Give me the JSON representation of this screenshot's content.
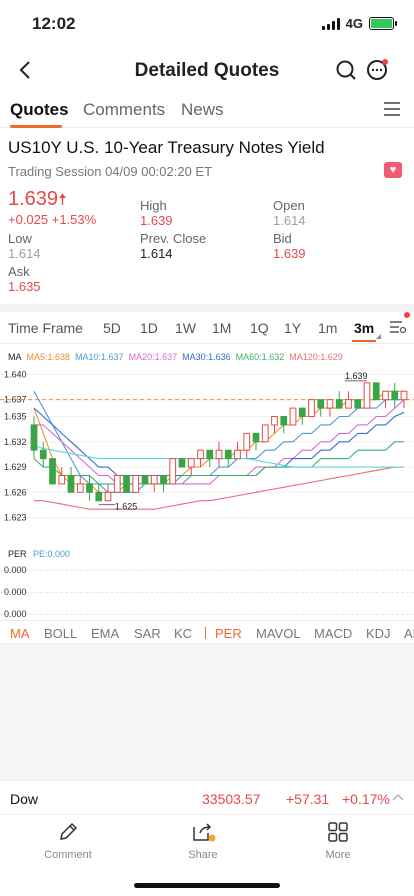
{
  "status": {
    "time": "12:02",
    "network": "4G"
  },
  "nav": {
    "title": "Detailed Quotes"
  },
  "tabs": [
    "Quotes",
    "Comments",
    "News"
  ],
  "quote": {
    "symbol_name": "US10Y  U.S. 10-Year Treasury Notes Yield",
    "session": "Trading Session 04/09 00:02:20 ET",
    "price": "1.639",
    "change": "+0.025  +1.53%",
    "high_label": "High",
    "high": "1.639",
    "open_label": "Open",
    "open": "1.614",
    "low_label": "Low",
    "low": "1.614",
    "prev_close_label": "Prev. Close",
    "prev_close": "1.614",
    "bid_label": "Bid",
    "bid": "1.639",
    "ask_label": "Ask",
    "ask": "1.635"
  },
  "timeframes": [
    "Time Frame",
    "5D",
    "1D",
    "1W",
    "1M",
    "1Q",
    "1Y",
    "1m",
    "3m"
  ],
  "active_timeframe": "3m",
  "ma_legend": [
    {
      "label": "MA",
      "color": "#222222"
    },
    {
      "label": "MA5:1.638",
      "color": "#f0922b"
    },
    {
      "label": "MA10:1.637",
      "color": "#4a9bd8"
    },
    {
      "label": "MA20:1.637",
      "color": "#d768d8"
    },
    {
      "label": "MA30:1.636",
      "color": "#2f6fd0"
    },
    {
      "label": "MA60:1.632",
      "color": "#3cb371"
    },
    {
      "label": "MA120:1.629",
      "color": "#e8707a"
    }
  ],
  "colors": {
    "up": "#e64a4a",
    "down": "#3aa547",
    "accent": "#f06a2b"
  },
  "chart_data": {
    "type": "candlestick",
    "y_ticks": [
      "1.640",
      "1.637",
      "1.635",
      "1.632",
      "1.629",
      "1.626",
      "1.623"
    ],
    "ylim": [
      1.622,
      1.641
    ],
    "ref_line": 1.637,
    "annotations": {
      "high": "1.639",
      "low": "1.625"
    },
    "ohlc": [
      [
        1.634,
        1.635,
        1.63,
        1.631
      ],
      [
        1.631,
        1.632,
        1.629,
        1.63
      ],
      [
        1.63,
        1.63,
        1.627,
        1.627
      ],
      [
        1.627,
        1.629,
        1.627,
        1.628
      ],
      [
        1.628,
        1.629,
        1.626,
        1.626
      ],
      [
        1.626,
        1.628,
        1.626,
        1.627
      ],
      [
        1.627,
        1.628,
        1.625,
        1.626
      ],
      [
        1.626,
        1.627,
        1.625,
        1.625
      ],
      [
        1.625,
        1.627,
        1.625,
        1.626
      ],
      [
        1.626,
        1.628,
        1.626,
        1.628
      ],
      [
        1.628,
        1.628,
        1.626,
        1.626
      ],
      [
        1.626,
        1.628,
        1.626,
        1.628
      ],
      [
        1.628,
        1.628,
        1.627,
        1.627
      ],
      [
        1.627,
        1.628,
        1.626,
        1.628
      ],
      [
        1.628,
        1.628,
        1.626,
        1.627
      ],
      [
        1.627,
        1.63,
        1.627,
        1.63
      ],
      [
        1.63,
        1.63,
        1.629,
        1.629
      ],
      [
        1.629,
        1.63,
        1.628,
        1.63
      ],
      [
        1.63,
        1.631,
        1.629,
        1.631
      ],
      [
        1.631,
        1.631,
        1.629,
        1.63
      ],
      [
        1.63,
        1.632,
        1.629,
        1.631
      ],
      [
        1.631,
        1.631,
        1.629,
        1.63
      ],
      [
        1.63,
        1.632,
        1.63,
        1.631
      ],
      [
        1.631,
        1.633,
        1.63,
        1.633
      ],
      [
        1.633,
        1.633,
        1.631,
        1.632
      ],
      [
        1.632,
        1.634,
        1.632,
        1.634
      ],
      [
        1.634,
        1.635,
        1.633,
        1.635
      ],
      [
        1.635,
        1.635,
        1.633,
        1.634
      ],
      [
        1.634,
        1.636,
        1.634,
        1.636
      ],
      [
        1.636,
        1.636,
        1.634,
        1.635
      ],
      [
        1.635,
        1.637,
        1.635,
        1.637
      ],
      [
        1.637,
        1.637,
        1.635,
        1.636
      ],
      [
        1.636,
        1.637,
        1.635,
        1.637
      ],
      [
        1.637,
        1.638,
        1.636,
        1.636
      ],
      [
        1.636,
        1.638,
        1.636,
        1.637
      ],
      [
        1.637,
        1.637,
        1.636,
        1.636
      ],
      [
        1.636,
        1.639,
        1.636,
        1.639
      ],
      [
        1.639,
        1.639,
        1.637,
        1.637
      ],
      [
        1.637,
        1.638,
        1.636,
        1.638
      ],
      [
        1.638,
        1.639,
        1.636,
        1.637
      ],
      [
        1.637,
        1.638,
        1.636,
        1.638
      ]
    ],
    "ma_series": [
      {
        "name": "MA5",
        "values": [
          1.636,
          1.633,
          1.63,
          1.628,
          1.627,
          1.627,
          1.627,
          1.626,
          1.626,
          1.626,
          1.627,
          1.627,
          1.627,
          1.627,
          1.627,
          1.628,
          1.628,
          1.629,
          1.629,
          1.63,
          1.63,
          1.63,
          1.631,
          1.631,
          1.632,
          1.632,
          1.633,
          1.634,
          1.634,
          1.635,
          1.635,
          1.636,
          1.636,
          1.636,
          1.637,
          1.637,
          1.637,
          1.637,
          1.638,
          1.638,
          1.638
        ]
      },
      {
        "name": "MA10",
        "values": [
          1.638,
          1.636,
          1.634,
          1.632,
          1.63,
          1.628,
          1.627,
          1.627,
          1.626,
          1.626,
          1.626,
          1.626,
          1.627,
          1.627,
          1.627,
          1.627,
          1.627,
          1.628,
          1.628,
          1.628,
          1.629,
          1.629,
          1.63,
          1.63,
          1.63,
          1.631,
          1.631,
          1.632,
          1.632,
          1.633,
          1.633,
          1.634,
          1.634,
          1.635,
          1.635,
          1.636,
          1.636,
          1.636,
          1.637,
          1.637,
          1.637
        ]
      },
      {
        "name": "MA20",
        "values": [
          1.634,
          1.634,
          1.633,
          1.632,
          1.631,
          1.63,
          1.629,
          1.628,
          1.628,
          1.627,
          1.627,
          1.627,
          1.627,
          1.627,
          1.627,
          1.627,
          1.627,
          1.627,
          1.627,
          1.627,
          1.628,
          1.628,
          1.628,
          1.628,
          1.629,
          1.629,
          1.629,
          1.63,
          1.63,
          1.631,
          1.631,
          1.632,
          1.632,
          1.633,
          1.633,
          1.634,
          1.634,
          1.635,
          1.635,
          1.636,
          1.637
        ]
      },
      {
        "name": "MA30",
        "values": [
          1.636,
          1.635,
          1.634,
          1.633,
          1.632,
          1.631,
          1.63,
          1.629,
          1.629,
          1.628,
          1.628,
          1.628,
          1.628,
          1.628,
          1.628,
          1.628,
          1.628,
          1.628,
          1.628,
          1.628,
          1.628,
          1.628,
          1.628,
          1.628,
          1.628,
          1.629,
          1.629,
          1.629,
          1.63,
          1.63,
          1.63,
          1.631,
          1.631,
          1.632,
          1.632,
          1.633,
          1.633,
          1.634,
          1.634,
          1.635,
          1.6355
        ]
      },
      {
        "name": "MA60",
        "values": [
          1.63,
          1.629,
          1.629,
          1.628,
          1.628,
          1.628,
          1.628,
          1.627,
          1.627,
          1.627,
          1.627,
          1.627,
          1.627,
          1.627,
          1.627,
          1.627,
          1.628,
          1.628,
          1.628,
          1.628,
          1.628,
          1.628,
          1.628,
          1.628,
          1.628,
          1.629,
          1.629,
          1.629,
          1.629,
          1.629,
          1.629,
          1.63,
          1.63,
          1.63,
          1.63,
          1.631,
          1.631,
          1.631,
          1.631,
          1.632,
          1.632
        ]
      },
      {
        "name": "MA120",
        "values": [
          1.625,
          1.625,
          1.6248,
          1.6246,
          1.6244,
          1.6242,
          1.624,
          1.624,
          1.624,
          1.624,
          1.624,
          1.624,
          1.624,
          1.624,
          1.6242,
          1.6244,
          1.6246,
          1.6248,
          1.625,
          1.625,
          1.6252,
          1.6254,
          1.6256,
          1.6258,
          1.626,
          1.6262,
          1.6264,
          1.6266,
          1.6268,
          1.627,
          1.6272,
          1.6274,
          1.6276,
          1.6278,
          1.628,
          1.6282,
          1.6284,
          1.6286,
          1.6288,
          1.629,
          1.629
        ]
      },
      {
        "name": "MA-cyan",
        "values": [
          1.6315,
          1.6312,
          1.631,
          1.6308,
          1.6306,
          1.6304,
          1.6302,
          1.63,
          1.63,
          1.63,
          1.63,
          1.63,
          1.63,
          1.63,
          1.63,
          1.63,
          1.63,
          1.63,
          1.63,
          1.63,
          1.63,
          1.63,
          1.63,
          1.63,
          1.6298,
          1.6296,
          1.6294,
          1.6292,
          1.629,
          1.629,
          1.629,
          1.629,
          1.629,
          1.629,
          1.629,
          1.629,
          1.629,
          1.629,
          1.629,
          1.629,
          1.629
        ]
      }
    ]
  },
  "per": {
    "label": "PER",
    "value_label": "PE:0.000",
    "axis": [
      "0.000",
      "0.000",
      "0.000"
    ]
  },
  "indicators": [
    "MA",
    "BOLL",
    "EMA",
    "SAR",
    "KC",
    "PER",
    "MAVOL",
    "MACD",
    "KDJ",
    "AR"
  ],
  "ticker": {
    "name": "Dow",
    "value": "33503.57",
    "change": "+57.31",
    "pct": "+0.17%"
  },
  "bottom": {
    "comment": "Comment",
    "share": "Share",
    "more": "More"
  }
}
